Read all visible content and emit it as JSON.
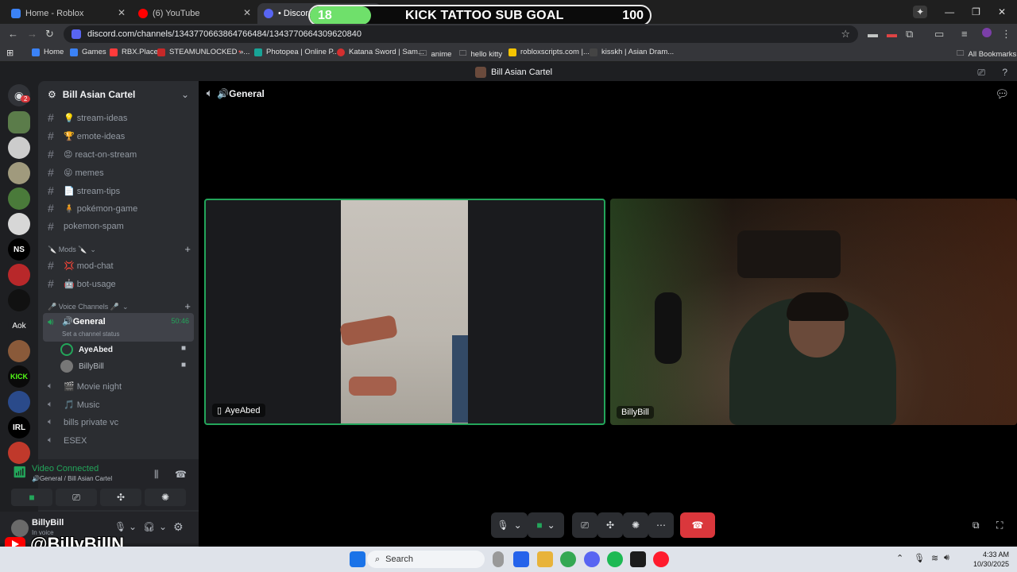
{
  "browser": {
    "tabs": [
      {
        "title": "Home - Roblox"
      },
      {
        "title": "(6) YouTube"
      },
      {
        "title": "• Discord |"
      },
      {
        "title": "K"
      }
    ],
    "url": "discord.com/channels/1343770663864766484/1343770664309620840",
    "bookmarks": [
      "Home",
      "Games",
      "RBX.Place",
      "STEAMUNLOCKED »...",
      "Photopea | Online P...",
      "Katana Sword | Sam...",
      "anime",
      "hello kitty",
      "robloxscripts.com |...",
      "kisskh | Asian Dram..."
    ],
    "all_bookmarks": "All Bookmarks"
  },
  "overlay": {
    "current": "18",
    "title": "KICK TATTOO SUB GOAL",
    "target": "100",
    "progress": 0.18
  },
  "discord": {
    "window_title": "Bill Asian Cartel",
    "notification_badge": "2",
    "server_name": "Bill Asian Cartel",
    "text_channels": [
      {
        "name": "💡 stream-ideas"
      },
      {
        "name": "🏆 emote-ideas"
      },
      {
        "name": "😡 react-on-stream"
      },
      {
        "name": "😝 memes"
      },
      {
        "name": "📄 stream-tips"
      },
      {
        "name": "🧍 pokémon-game"
      },
      {
        "name": "pokemon-spam"
      }
    ],
    "mods_category": "🔪 Mods 🔪",
    "mod_channels": [
      {
        "name": "💢 mod-chat"
      },
      {
        "name": "🤖 bot-usage"
      }
    ],
    "voice_category": "🎤 Voice Channels 🎤",
    "active_voice": {
      "name": "🔊General",
      "timer": "50:46",
      "status_hint": "Set a channel status"
    },
    "voice_users": [
      "AyeAbed",
      "BillyBill"
    ],
    "other_voice": [
      {
        "name": "🎬 Movie night"
      },
      {
        "name": "🎵 Music"
      },
      {
        "name": "bills private vc"
      },
      {
        "name": "ESEX"
      }
    ],
    "voice_panel": {
      "status": "Video Connected",
      "location": "🔊General / Bill Asian Cartel"
    },
    "user": {
      "name": "BillyBill",
      "status": "In voice"
    },
    "stage_title": "🔊General",
    "tiles": [
      {
        "name": "AyeAbed"
      },
      {
        "name": "BillyBill"
      }
    ]
  },
  "watermark": "@BillyBillN",
  "taskbar": {
    "search_placeholder": "Search",
    "time": "4:33 AM",
    "date": "10/30/2025"
  },
  "colors": {
    "discord_bg": "#1e1f22",
    "sidebar": "#2b2d31",
    "speaking_green": "#23a55a",
    "disconnect_red": "#da373c",
    "goal_green": "#6fe06b"
  }
}
